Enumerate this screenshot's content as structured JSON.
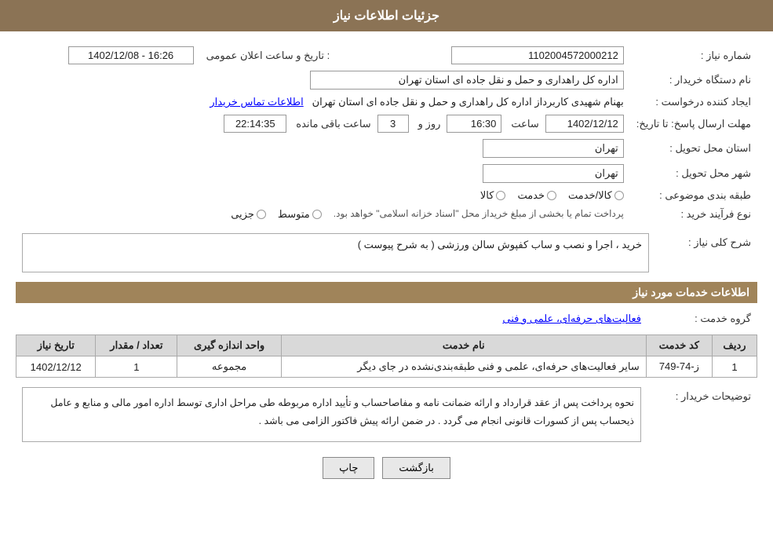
{
  "header": {
    "title": "جزئیات اطلاعات نیاز"
  },
  "fields": {
    "need_number_label": "شماره نیاز :",
    "need_number_value": "1102004572000212",
    "buyer_org_label": "نام دستگاه خریدار :",
    "buyer_org_value": "اداره کل راهداری و حمل و نقل جاده ای استان تهران",
    "creator_label": "ایجاد کننده درخواست :",
    "creator_value": "بهنام شهیدی کاربرداز اداره کل راهداری و حمل و نقل جاده ای استان تهران",
    "creator_contact_link": "اطلاعات تماس خریدار",
    "announce_label": "تاریخ و ساعت اعلان عمومی :",
    "announce_value": "1402/12/08 - 16:26",
    "response_deadline_label": "مهلت ارسال پاسخ: تا تاریخ:",
    "response_date": "1402/12/12",
    "response_time_label": "ساعت",
    "response_time": "16:30",
    "response_days_label": "روز و",
    "response_days": "3",
    "remaining_time_label": "ساعت باقی مانده",
    "remaining_time": "22:14:35",
    "province_label": "استان محل تحویل :",
    "province_value": "تهران",
    "city_label": "شهر محل تحویل :",
    "city_value": "تهران",
    "category_label": "طبقه بندی موضوعی :",
    "category_options": [
      {
        "label": "کالا",
        "checked": false
      },
      {
        "label": "خدمت",
        "checked": false
      },
      {
        "label": "کالا/خدمت",
        "checked": false
      }
    ],
    "process_label": "نوع فرآیند خرید :",
    "process_options": [
      {
        "label": "جزیی",
        "checked": false
      },
      {
        "label": "متوسط",
        "checked": false
      }
    ],
    "process_note": "پرداخت تمام یا بخشی از مبلغ خریداز محل \"اسناد خزانه اسلامی\" خواهد بود.",
    "need_description_label": "شرح کلی نیاز :",
    "need_description": "خرید ، اجرا و نصب و ساب کفپوش سالن ورزشی ( به شرح پیوست )",
    "services_section_label": "اطلاعات خدمات مورد نیاز",
    "service_group_label": "گروه خدمت :",
    "service_group_value": "فعالیت‌های حرفه‌ای، علمی و فنی",
    "table": {
      "headers": [
        "ردیف",
        "کد خدمت",
        "نام خدمت",
        "واحد اندازه گیری",
        "تعداد / مقدار",
        "تاریخ نیاز"
      ],
      "rows": [
        {
          "row": "1",
          "code": "ز-74-749",
          "name": "سایر فعالیت‌های حرفه‌ای، علمی و فنی طبقه‌بندی‌نشده در جای دیگر",
          "unit": "مجموعه",
          "qty": "1",
          "date": "1402/12/12"
        }
      ]
    },
    "buyer_notes_label": "توضیحات خریدار :",
    "buyer_notes": "نحوه پرداخت پس از عقد قرارداد و ارائه ضمانت نامه و مفاصاحساب و تأیید اداره مربوطه طی مراحل اداری توسط اداره امور مالی و منابع و عامل ذیحساب پس از کسورات قانونی انجام می گردد . در ضمن ارائه پیش فاکتور الزامی می باشد .",
    "buttons": {
      "print_label": "چاپ",
      "back_label": "بازگشت"
    }
  }
}
